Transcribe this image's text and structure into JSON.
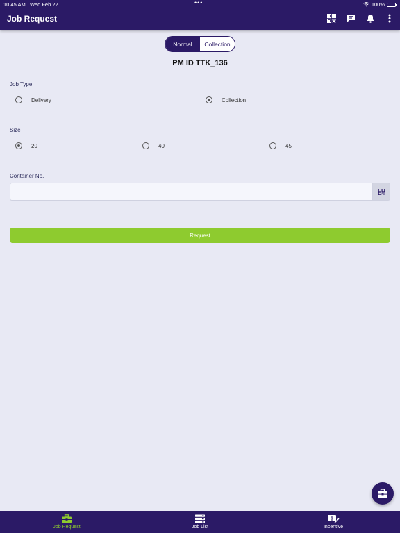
{
  "status_bar": {
    "time": "10:45 AM",
    "date": "Wed Feb 22",
    "multitask_dots": "•••",
    "battery": "100%"
  },
  "header": {
    "title": "Job Request",
    "icons": [
      "qr-code-icon",
      "message-icon",
      "bell-icon",
      "more-vertical-icon"
    ]
  },
  "mode_toggle": {
    "options": [
      "Normal",
      "Collection"
    ],
    "selected": "Normal"
  },
  "pm_id": "PM ID TTK_136",
  "job_type": {
    "label": "Job Type",
    "options": [
      "Delivery",
      "Collection"
    ],
    "selected": "Collection"
  },
  "size": {
    "label": "Size",
    "options": [
      "20",
      "40",
      "45"
    ],
    "selected": "20"
  },
  "container": {
    "label": "Container No.",
    "value": "",
    "placeholder": ""
  },
  "request_button": "Request",
  "bottom_nav": {
    "items": [
      {
        "label": "Job Request",
        "icon": "briefcase-icon",
        "active": true
      },
      {
        "label": "Job List",
        "icon": "list-icon",
        "active": false
      },
      {
        "label": "Incentive",
        "icon": "money-icon",
        "active": false
      }
    ]
  },
  "colors": {
    "primary": "#2b1a66",
    "accent": "#8ecb2f",
    "background": "#e8e9f4"
  }
}
